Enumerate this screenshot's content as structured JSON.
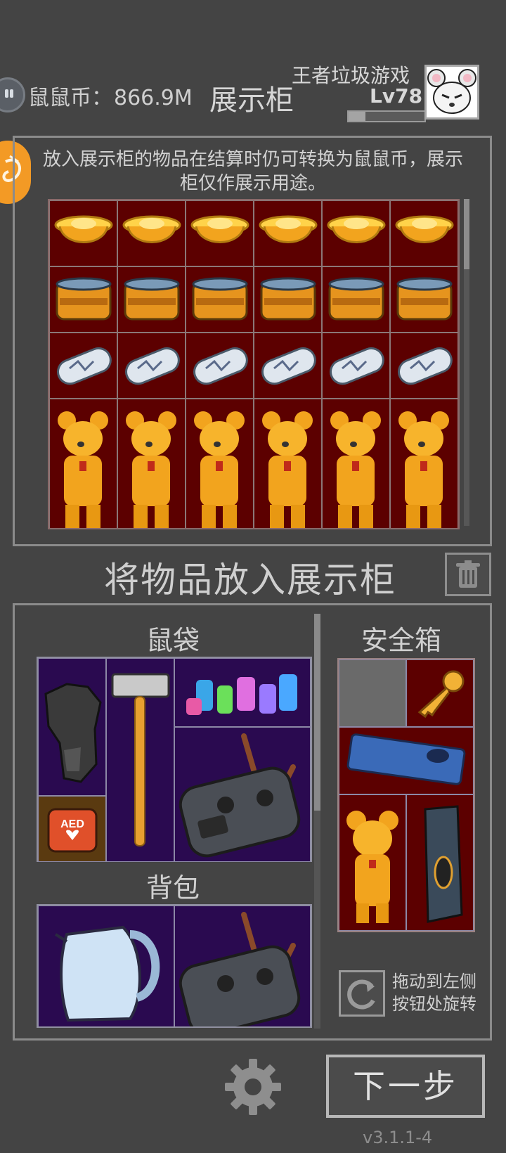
{
  "header": {
    "coin_label": "鼠鼠币：",
    "coin_value": "866.9M",
    "page_title": "展示柜",
    "player_name": "王者垃圾游戏",
    "level": "Lv78",
    "xp_progress": 0.22
  },
  "showcase": {
    "description": "放入展示柜的物品在结算时仍可转换为鼠鼠币，展示柜仅作展示用途。",
    "rows": [
      {
        "item": "gold-ingot-icon",
        "count": 6
      },
      {
        "item": "gold-tin-can-icon",
        "count": 6
      },
      {
        "item": "glass-capsule-icon",
        "count": 6
      },
      {
        "item": "golden-bear-statue-icon",
        "count": 6
      }
    ]
  },
  "section": {
    "put_title": "将物品放入展示柜"
  },
  "bag": {
    "title": "鼠袋",
    "items": [
      "tactical-boot-icon",
      "sledgehammer-icon",
      "potion-bottles-icon",
      "remote-controller-icon",
      "aed-kit-icon"
    ]
  },
  "backpack": {
    "title": "背包",
    "items": [
      "electric-kettle-icon",
      "remote-controller-icon"
    ]
  },
  "safe_box": {
    "title": "安全箱",
    "items": [
      "gold-key-icon",
      "graphics-card-icon",
      "golden-bear-statue-icon",
      "device-module-icon"
    ]
  },
  "rotate": {
    "hint_line1": "拖动到左侧",
    "hint_line2": "按钮处旋转"
  },
  "footer": {
    "next_label": "下一步",
    "version": "v3.1.1-4"
  },
  "colors": {
    "background": "#444444",
    "showcase_cell": "#5c0000",
    "bag_cell": "#2a0a50",
    "badge": "#f39a25"
  }
}
